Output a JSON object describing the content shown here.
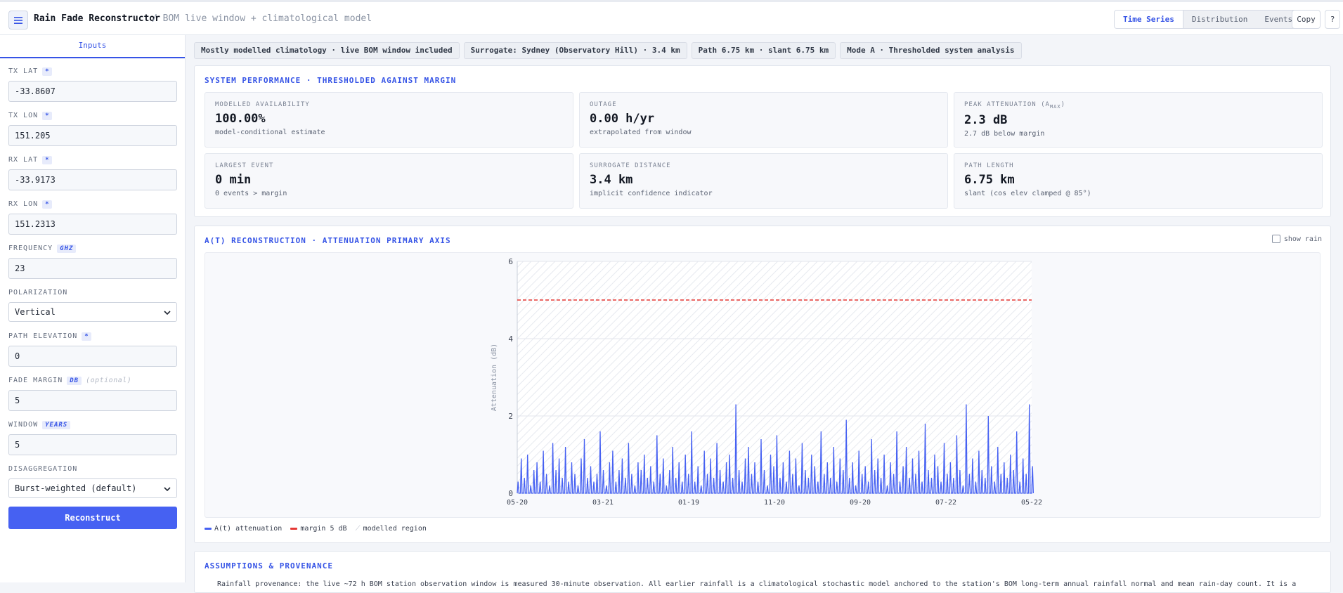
{
  "app": {
    "title": "Rain Fade Reconstructor",
    "subtitle": "/ BOM live window + climatological model"
  },
  "header": {
    "tabs": [
      {
        "label": "Time Series",
        "active": true
      },
      {
        "label": "Distribution",
        "active": false
      },
      {
        "label": "Events",
        "active": false
      }
    ],
    "copy_label": "Copy",
    "help_label": "?"
  },
  "sidebar": {
    "tab_label": "Inputs",
    "fields": {
      "tx_lat": {
        "label": "TX LAT",
        "badge": "*",
        "value": "-33.8607"
      },
      "tx_lon": {
        "label": "TX LON",
        "badge": "*",
        "value": "151.205"
      },
      "rx_lat": {
        "label": "RX LAT",
        "badge": "*",
        "value": "-33.9173"
      },
      "rx_lon": {
        "label": "RX LON",
        "badge": "*",
        "value": "151.2313"
      },
      "frequency": {
        "label": "FREQUENCY",
        "unit": "GHZ",
        "value": "23"
      },
      "polarization": {
        "label": "POLARIZATION",
        "value": "Vertical"
      },
      "path_elevation": {
        "label": "PATH ELEVATION",
        "badge": "*",
        "value": "0"
      },
      "fade_margin": {
        "label": "FADE MARGIN",
        "unit": "DB",
        "optional": "(optional)",
        "value": "5"
      },
      "window": {
        "label": "WINDOW",
        "unit": "YEARS",
        "value": "5"
      },
      "disaggregation": {
        "label": "DISAGGREGATION",
        "value": "Burst-weighted (default)"
      }
    },
    "reconstruct_label": "Reconstruct"
  },
  "chips": [
    "Mostly modelled climatology · live BOM window included",
    "Surrogate: Sydney (Observatory Hill) · 3.4 km",
    "Path 6.75 km · slant 6.75 km",
    "Mode A · Thresholded system analysis"
  ],
  "performance": {
    "title": "SYSTEM PERFORMANCE · THRESHOLDED AGAINST MARGIN",
    "metrics": [
      {
        "label": "MODELLED AVAILABILITY",
        "value": "100.00%",
        "sub": "model-conditional estimate"
      },
      {
        "label": "OUTAGE",
        "value": "0.00 h/yr",
        "sub": "extrapolated from window"
      },
      {
        "label": "PEAK ATTENUATION (A",
        "label_sub": "MAX",
        "label_end": ")",
        "value": "2.3 dB",
        "sub": "2.7 dB below margin"
      },
      {
        "label": "LARGEST EVENT",
        "value": "0 min",
        "sub": "0 events > margin"
      },
      {
        "label": "SURROGATE DISTANCE",
        "value": "3.4 km",
        "sub": "implicit confidence indicator"
      },
      {
        "label": "PATH LENGTH",
        "value": "6.75 km",
        "sub": "slant (cos elev clamped @ 85°)"
      }
    ]
  },
  "chart_section": {
    "title": "A(T) RECONSTRUCTION · ATTENUATION PRIMARY AXIS",
    "show_rain_label": "show rain",
    "show_rain_checked": false,
    "legend": [
      {
        "label": "A(t) attenuation",
        "color": "#4661f2"
      },
      {
        "label": "margin 5 dB",
        "color": "#e53935"
      },
      {
        "label": "modelled region",
        "color": "#c9ced9"
      }
    ]
  },
  "chart_data": {
    "type": "line",
    "ylabel": "Attenuation (dB)",
    "ylim": [
      0,
      6
    ],
    "yticks": [
      "0",
      "2",
      "4",
      "6"
    ],
    "x_tick_labels": [
      "05-20",
      "03-21",
      "01-19",
      "11-20",
      "09-20",
      "07-22",
      "05-22"
    ],
    "margin_db": 5,
    "grid": true,
    "series": [
      {
        "name": "A(t) attenuation",
        "color": "#4661f2",
        "values": [
          0.3,
          0.9,
          0.4,
          1.0,
          0.2,
          0.6,
          0.8,
          0.3,
          1.1,
          0.5,
          0.2,
          1.3,
          0.6,
          0.9,
          0.4,
          1.2,
          0.3,
          0.8,
          0.5,
          0.2,
          0.9,
          1.4,
          0.4,
          0.7,
          0.3,
          0.5,
          1.6,
          0.6,
          0.2,
          0.8,
          1.1,
          0.3,
          0.6,
          0.9,
          0.4,
          1.3,
          0.5,
          0.2,
          0.8,
          0.6,
          1.0,
          0.4,
          0.7,
          0.3,
          1.5,
          0.5,
          0.9,
          0.2,
          0.6,
          1.2,
          0.4,
          0.8,
          0.3,
          1.0,
          0.5,
          1.6,
          0.3,
          0.7,
          0.2,
          1.1,
          0.5,
          0.9,
          0.4,
          1.3,
          0.6,
          0.3,
          0.8,
          1.0,
          0.4,
          2.3,
          0.6,
          0.3,
          0.9,
          1.2,
          0.5,
          0.8,
          0.3,
          1.4,
          0.6,
          0.2,
          1.0,
          0.7,
          1.5,
          0.4,
          0.8,
          0.3,
          1.1,
          0.5,
          0.9,
          0.2,
          1.3,
          0.6,
          0.4,
          1.0,
          0.7,
          0.3,
          1.6,
          0.5,
          0.8,
          0.4,
          1.2,
          0.3,
          0.9,
          0.6,
          1.9,
          0.4,
          0.8,
          0.2,
          1.1,
          0.5,
          0.7,
          0.3,
          1.4,
          0.6,
          0.9,
          0.4,
          1.0,
          0.2,
          0.8,
          0.5,
          1.6,
          0.3,
          0.7,
          1.2,
          0.4,
          0.9,
          0.5,
          1.1,
          0.3,
          1.8,
          0.6,
          0.4,
          1.0,
          0.7,
          0.3,
          1.3,
          0.5,
          0.8,
          0.4,
          1.5,
          0.6,
          0.2,
          2.3,
          0.5,
          0.9,
          0.3,
          1.1,
          0.6,
          0.4,
          2.0,
          0.7,
          0.3,
          1.2,
          0.5,
          0.8,
          0.4,
          1.0,
          0.6,
          1.6,
          0.3,
          0.9,
          0.5,
          2.3,
          0.7
        ]
      }
    ]
  },
  "provenance": {
    "title": "ASSUMPTIONS & PROVENANCE",
    "text": "Rainfall provenance: the live ~72 h BOM station observation window is measured 30-minute observation. All earlier rainfall is a climatological stochastic model anchored to the station's BOM long-term annual rainfall normal and mean rain-day count. It is a"
  }
}
